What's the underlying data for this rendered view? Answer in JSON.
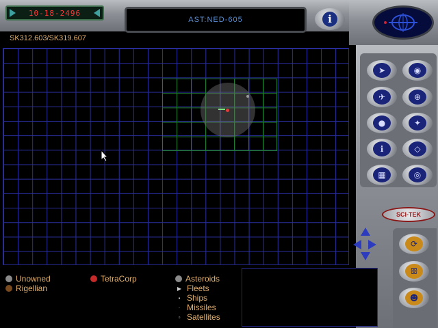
{
  "header": {
    "date": "10-18-2496",
    "object_name": "AST:NED-605",
    "coordinates": "SK312.603/SK319.607"
  },
  "legend": {
    "owners": [
      {
        "label": "Unowned",
        "color": "#8a8a8a"
      },
      {
        "label": "Rigellian",
        "color": "#7a4a1f"
      },
      {
        "label": "TetraCorp",
        "color": "#c42a2a"
      }
    ],
    "objects": [
      {
        "label": "Asteroids",
        "marker": "circle",
        "color": "#8a8a8a"
      },
      {
        "label": "Fleets",
        "marker": "triangle"
      },
      {
        "label": "Ships",
        "marker": "dot"
      },
      {
        "label": "Missiles",
        "marker": "small-dot"
      },
      {
        "label": "Satellites",
        "marker": "square"
      }
    ]
  },
  "toolbar": {
    "buttons": [
      {
        "icon": "ship-arrow-icon"
      },
      {
        "icon": "planet-eye-icon"
      },
      {
        "icon": "ship-split-icon"
      },
      {
        "icon": "target-globe-icon"
      },
      {
        "icon": "fleet-planet-icon"
      },
      {
        "icon": "fleet-target-icon"
      },
      {
        "icon": "info-planet-icon"
      },
      {
        "icon": "diamond-scan-icon"
      },
      {
        "icon": "grid-map-icon"
      },
      {
        "icon": "eye-scan-icon"
      }
    ],
    "brand": "SCI-TEK",
    "lower_buttons": [
      {
        "icon": "cycle-icon"
      },
      {
        "icon": "butterfly-icon"
      },
      {
        "icon": "alien-head-icon"
      }
    ]
  },
  "colors": {
    "grid": "#2a2fa0",
    "sector_grid": "#1f7a2f",
    "legend_text": "#e0b070",
    "name_text": "#5a8fd6",
    "date_text": "#ff3b3b"
  }
}
